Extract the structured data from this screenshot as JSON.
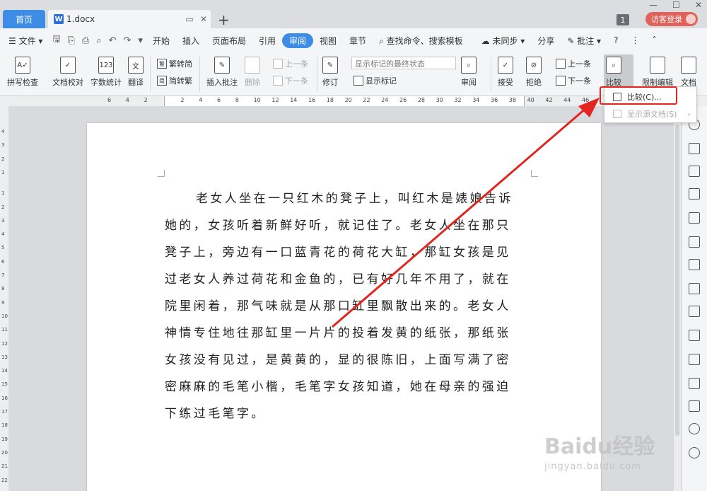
{
  "titlebar": {
    "home_tab": "首页",
    "doc_tab": "1.docx",
    "new_tab": "+",
    "badge": "1",
    "login": "访客登录"
  },
  "menu": {
    "file": "文件",
    "items": [
      "开始",
      "插入",
      "页面布局",
      "引用",
      "审阅",
      "视图",
      "章节"
    ],
    "active": "审阅",
    "search": "查找命令、搜索模板",
    "sync": "未同步",
    "share": "分享",
    "comment": "批注"
  },
  "ribbon": {
    "spell_check": "拼写检查",
    "proofread": "文档校对",
    "word_count": "字数统计",
    "translate": "翻译",
    "trad_to_simp": "繁转简",
    "simp_to_trad": "简转繁",
    "insert_comment": "插入批注",
    "delete": "删除",
    "prev_comment": "上一条",
    "next_comment": "下一条",
    "track_changes": "修订",
    "display_select": "显示标记的最终状态",
    "show_markup": "显示标记",
    "review": "审阅",
    "accept": "接受",
    "reject": "拒绝",
    "prev": "上一条",
    "next": "下一条",
    "compare": "比较",
    "restrict_edit": "限制编辑",
    "document": "文档"
  },
  "dropdown": {
    "compare_item": "比较(C)...",
    "show_source": "显示源文档(S)"
  },
  "ruler": {
    "labels": [
      "6",
      "4",
      "2",
      "2",
      "4",
      "6",
      "8",
      "10",
      "12",
      "14",
      "16",
      "18",
      "20",
      "22",
      "24",
      "26",
      "28",
      "30",
      "32",
      "34",
      "36",
      "38",
      "40",
      "42",
      "44",
      "46"
    ],
    "vlabels": [
      "4",
      "3",
      "2",
      "1",
      "1",
      "2",
      "3",
      "4",
      "5",
      "6",
      "7",
      "8",
      "9",
      "10",
      "11",
      "12",
      "13",
      "14",
      "15",
      "16",
      "17",
      "18",
      "19",
      "20",
      "21",
      "22"
    ]
  },
  "document": {
    "paragraph": "老女人坐在一只红木的凳子上，叫红木是婊娘告诉她的，女孩听着新鲜好听，就记住了。老女人坐在那只凳子上，旁边有一口蓝青花的荷花大缸，那缸女孩是见过老女人养过荷花和金鱼的，已有好几年不用了，就在院里闲着，那气味就是从那口缸里飘散出来的。老女人神情专住地往那缸里一片片的投着发黄的纸张，那纸张女孩没有见过，是黄黄的，显的很陈旧，上面写满了密密麻麻的毛笔小楷，毛笔字女孩知道，她在母亲的强迫下练过毛笔字。"
  },
  "watermark": {
    "brand": "Baidu经验",
    "url": "jingyan.baidu.com"
  },
  "colors": {
    "accent": "#3d8ce5",
    "highlight": "#e2251f",
    "login": "#e0625a"
  }
}
